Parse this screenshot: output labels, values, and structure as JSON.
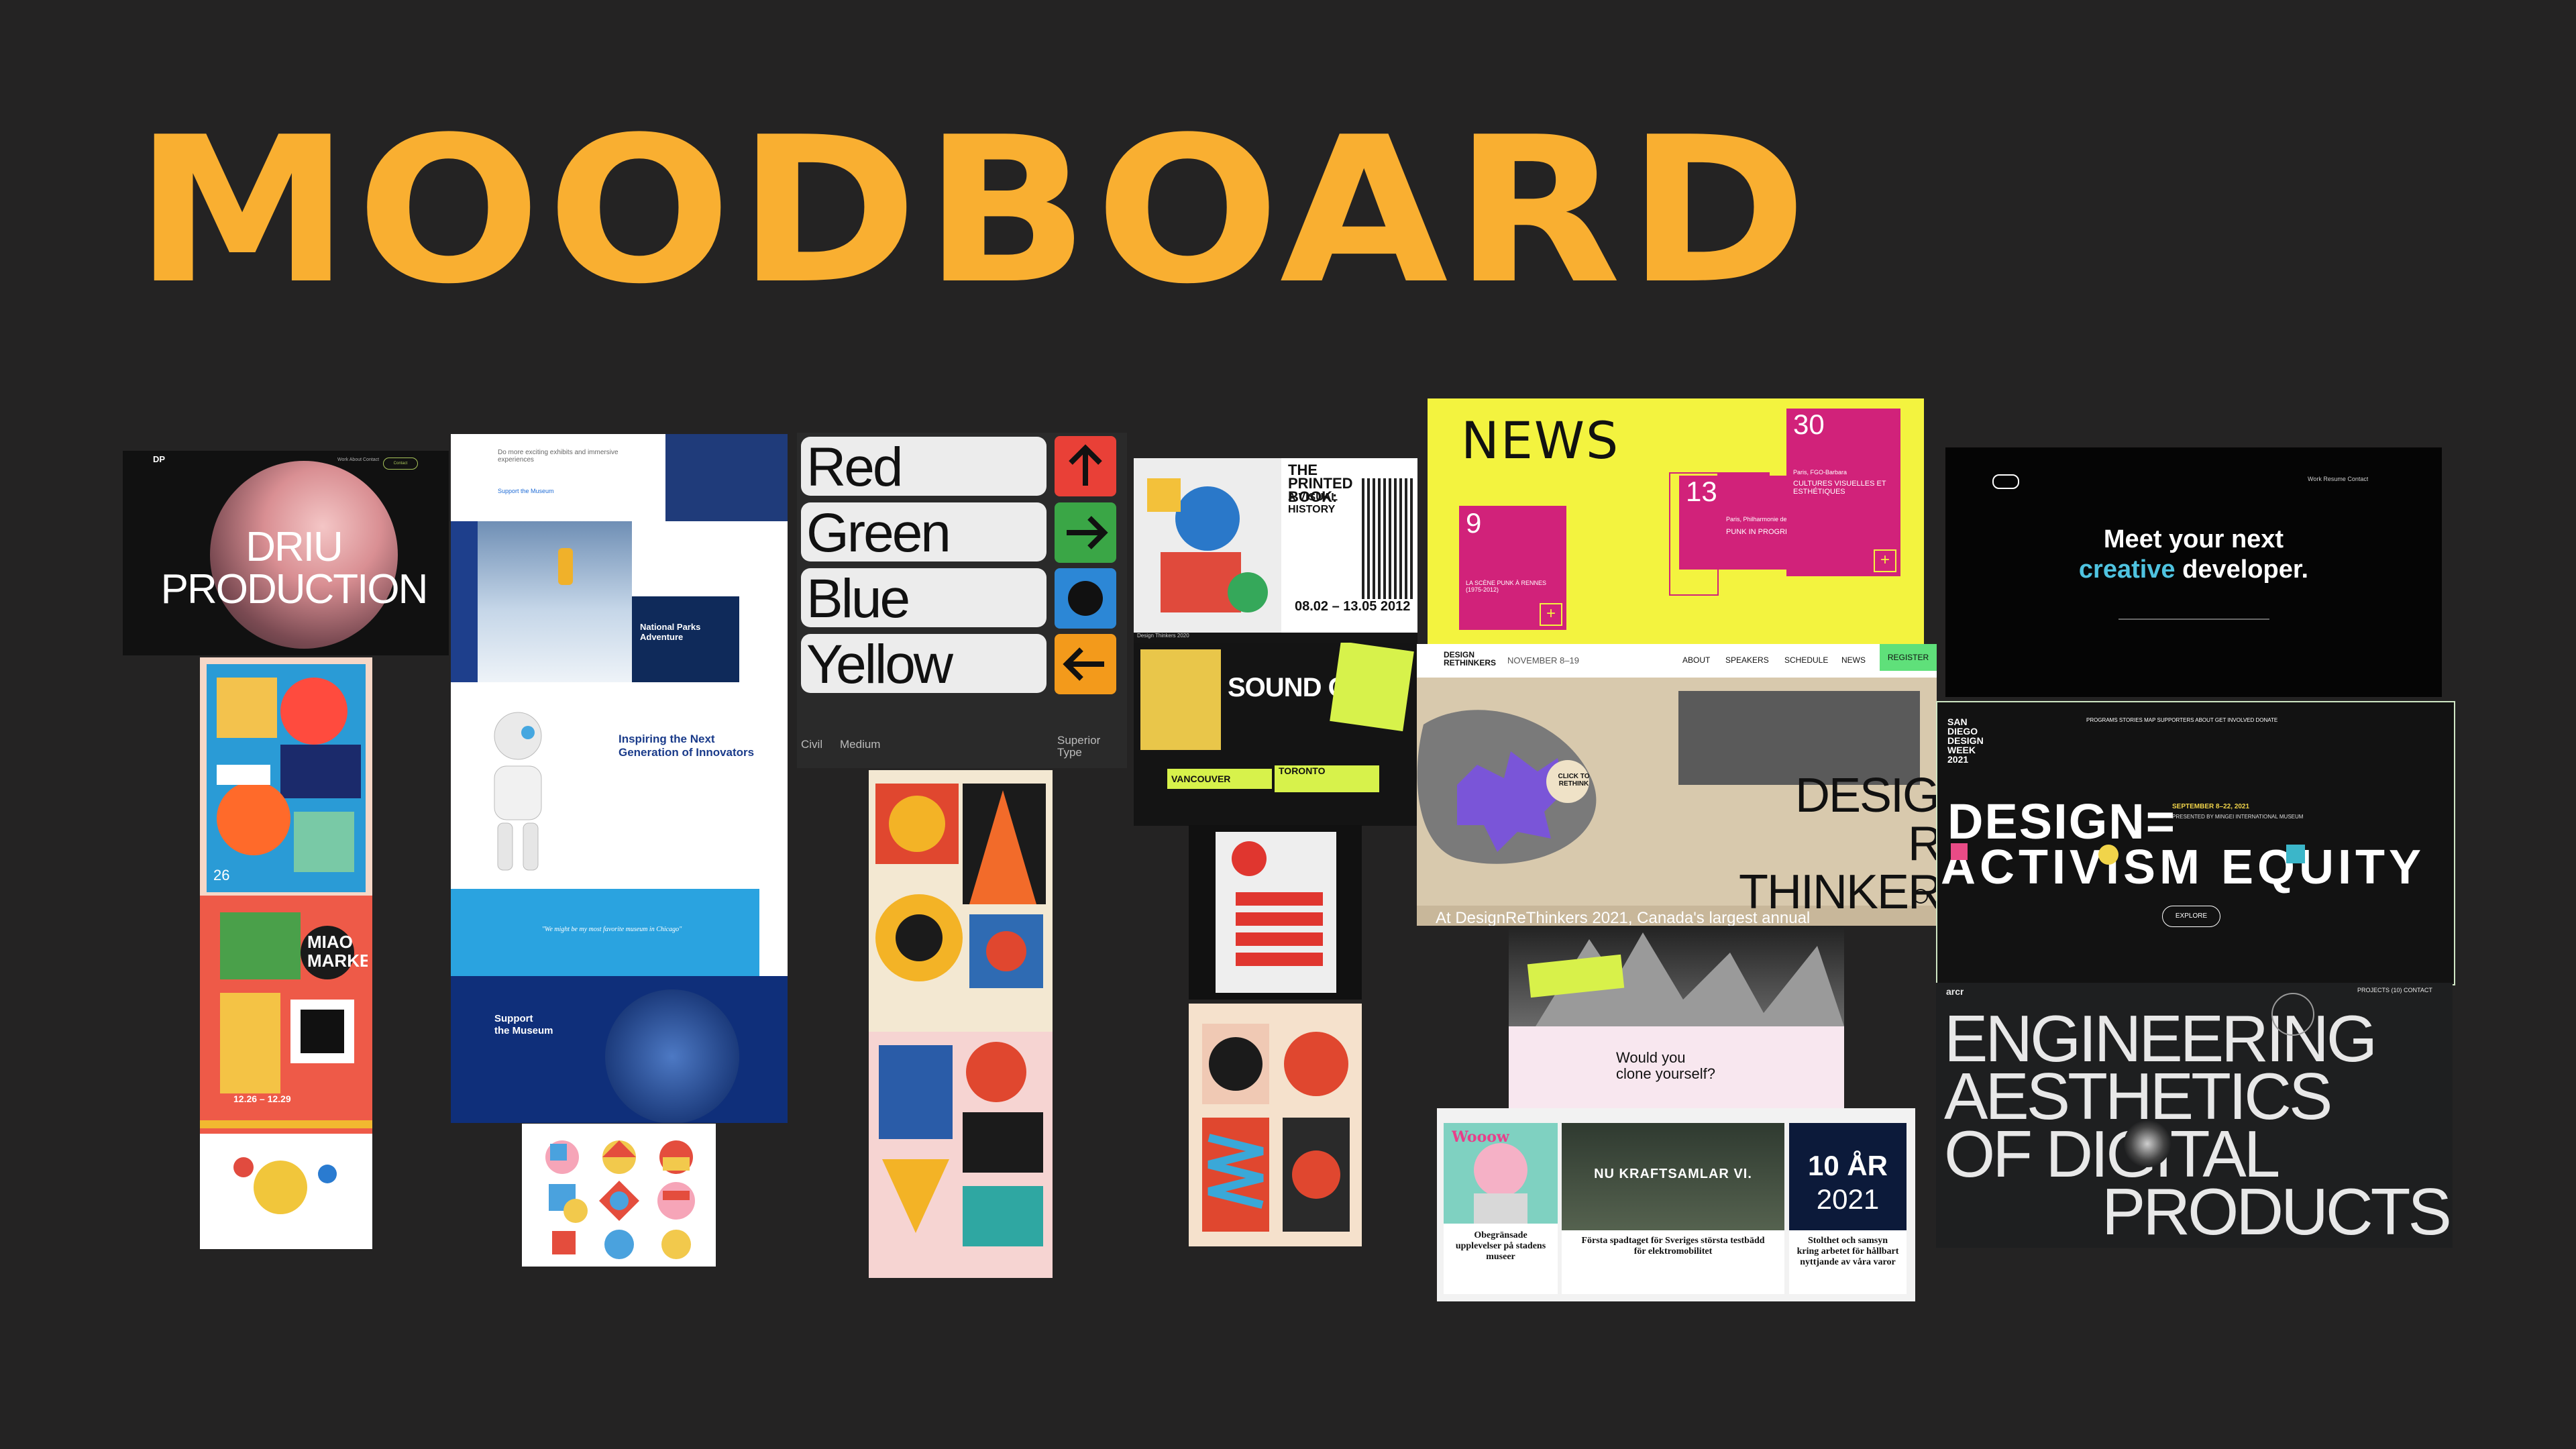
{
  "title": "MOODBOARD",
  "dp": {
    "logo": "DP",
    "nav": "Work  About  Contact",
    "cta": "Contact",
    "headline_1": "DRIU",
    "headline_2": "PRODUCTION"
  },
  "national_parks": {
    "hero_text": "Do more exciting exhibits and immersive experiences",
    "support_link": "Support the Museum",
    "card_title": "National Parks Adventure",
    "section_title": "Inspiring the Next Generation of Innovators",
    "quote": "\"We might be my most favorite museum in Chicago\"",
    "footer_title_1": "Support",
    "footer_title_2": "the Museum"
  },
  "rgby": {
    "words": [
      "Red",
      "Green",
      "Blue",
      "Yellow"
    ],
    "arrows": [
      "↑",
      "→",
      "●",
      "←"
    ],
    "colors": [
      "#e94037",
      "#3aa646",
      "#2c87d6",
      "#f39a1b"
    ],
    "footer": [
      "Civil",
      "Medium",
      "Superior Type"
    ]
  },
  "news": {
    "heading": "NEWS",
    "num_30": "30",
    "num_9": "9",
    "num_13": "13",
    "text_a": "Paris, FGO-Barbara",
    "text_b": "CULTURES VISUELLES ET ESTHÉTIQUES",
    "text_c": "LA SCÈNE PUNK À RENNES (1975-2012)",
    "text_d": "Paris, Philharmonie de Paris",
    "text_e": "PUNK IN PROGRESS",
    "plus": "+"
  },
  "meet": {
    "line1": "Meet your next",
    "word_creative": "creative",
    "word_developer": "developer.",
    "nav": "Work  Resume  Contact"
  },
  "drt": {
    "brand": "DESIGN RETHINKERS",
    "dates": "NOVEMBER 8–19",
    "nav": [
      "ABOUT",
      "SPEAKERS",
      "SCHEDULE",
      "NEWS"
    ],
    "register": "REGISTER",
    "big_1": "DESIGN",
    "big_2": "RE THINKERS",
    "foot": "At DesignReThinkers 2021, Canada's largest annual",
    "badge": "CLICK TO RETHINK"
  },
  "sddw": {
    "logo": "SAN DIEGO DESIGN WEEK 2021",
    "nav": "PROGRAMS  STORIES  MAP  SUPPORTERS  ABOUT  GET INVOLVED  DONATE",
    "word_1": "DESIGN=",
    "word_2": "ACTIVISM EQUITY",
    "date": "SEPTEMBER 8–22, 2021",
    "presented": "PRESENTED BY MINGEI INTERNATIONAL MUSEUM",
    "explore": "EXPLORE"
  },
  "eng": {
    "brand": "arcr",
    "nav": "PROJECTS (10)  CONTACT",
    "line1": "ENGINEERING",
    "line2": "AESTHETICS",
    "line3": "OF DIGITAL",
    "line4": "PRODUCTS"
  },
  "sound": {
    "header": "Design Thinkers 2020",
    "title": "SOUND ON",
    "vancouver": "VANCOUVER",
    "toronto": "TORONTO",
    "printed_book_1": "THE PRINTED BOOK:",
    "printed_book_2": "A VISUAL HISTORY",
    "dates": "08.02 – 13.05 2012"
  },
  "clone": {
    "question": "Would you clone yourself?"
  },
  "se": {
    "hero": "NU KRAFTSAMLAR VI.",
    "years_1": "10 ÅR",
    "years_2": "2021",
    "cap1": "Obegränsade upplevelser på stadens museer",
    "cap2": "Första spadtaget för Sveriges största testbädd för elektromobilitet",
    "cap3": "Stolthet och samsyn kring arbetet för hållbart nyttjande av våra varor",
    "woow": "Wooow"
  },
  "miao": {
    "title": "MIAO MARKET",
    "dates": "12.26 – 12.29",
    "number": "26"
  }
}
